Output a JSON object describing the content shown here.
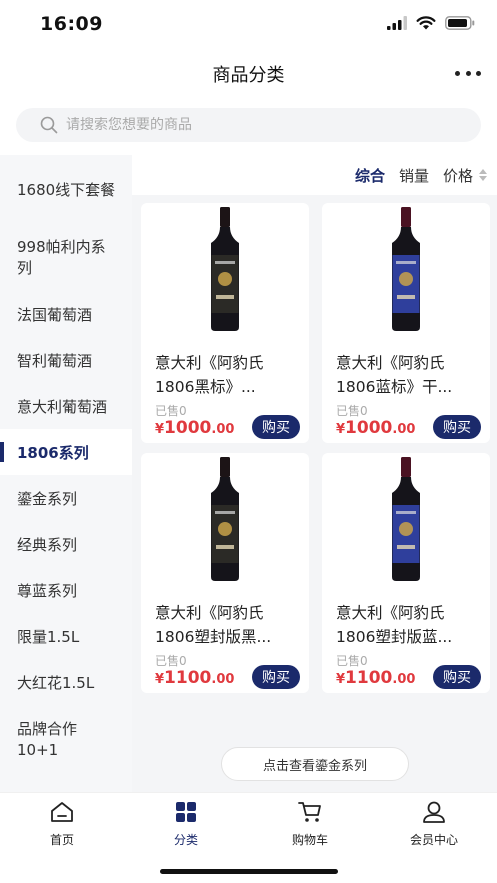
{
  "status_bar": {
    "time": "16:09"
  },
  "header": {
    "title": "商品分类",
    "more_icon": "more-dots-icon"
  },
  "search": {
    "placeholder": "请搜索您想要的商品",
    "value": ""
  },
  "sidebar": {
    "items": [
      {
        "label": "1680线下套餐",
        "active": false
      },
      {
        "label": "998帕利内系列",
        "active": false
      },
      {
        "label": "法国葡萄酒",
        "active": false
      },
      {
        "label": "智利葡萄酒",
        "active": false
      },
      {
        "label": "意大利葡萄酒",
        "active": false
      },
      {
        "label": "1806系列",
        "active": true
      },
      {
        "label": "鎏金系列",
        "active": false
      },
      {
        "label": "经典系列",
        "active": false
      },
      {
        "label": "尊蓝系列",
        "active": false
      },
      {
        "label": "限量1.5L",
        "active": false
      },
      {
        "label": "大红花1.5L",
        "active": false
      },
      {
        "label": "品牌合作10+1",
        "active": false
      }
    ]
  },
  "sort": {
    "comprehensive": "综合",
    "sales": "销量",
    "price": "价格"
  },
  "products": [
    {
      "title": "意大利《阿豹氏1806黑标》...",
      "sold": "已售0",
      "currency": "¥",
      "price_int": "1000",
      "price_dec": ".00",
      "buy_label": "购买",
      "label_color": "#2b2a26"
    },
    {
      "title": "意大利《阿豹氏1806蓝标》干...",
      "sold": "已售0",
      "currency": "¥",
      "price_int": "1000",
      "price_dec": ".00",
      "buy_label": "购买",
      "label_color": "#2f3f9c"
    },
    {
      "title": "意大利《阿豹氏1806塑封版黑...",
      "sold": "已售0",
      "currency": "¥",
      "price_int": "1100",
      "price_dec": ".00",
      "buy_label": "购买",
      "label_color": "#2b2a26"
    },
    {
      "title": "意大利《阿豹氏1806塑封版蓝...",
      "sold": "已售0",
      "currency": "¥",
      "price_int": "1100",
      "price_dec": ".00",
      "buy_label": "购买",
      "label_color": "#2f3f9c"
    }
  ],
  "more_series_label": "点击查看鎏金系列",
  "tabs": [
    {
      "label": "首页",
      "icon": "home-icon",
      "active": false
    },
    {
      "label": "分类",
      "icon": "category-icon",
      "active": true
    },
    {
      "label": "购物车",
      "icon": "cart-icon",
      "active": false
    },
    {
      "label": "会员中心",
      "icon": "member-icon",
      "active": false
    }
  ],
  "colors": {
    "accent": "#1b2a6b",
    "price": "#e0393e",
    "sidebar_bg": "#f6f7f9",
    "content_bg": "#f4f5f7"
  }
}
